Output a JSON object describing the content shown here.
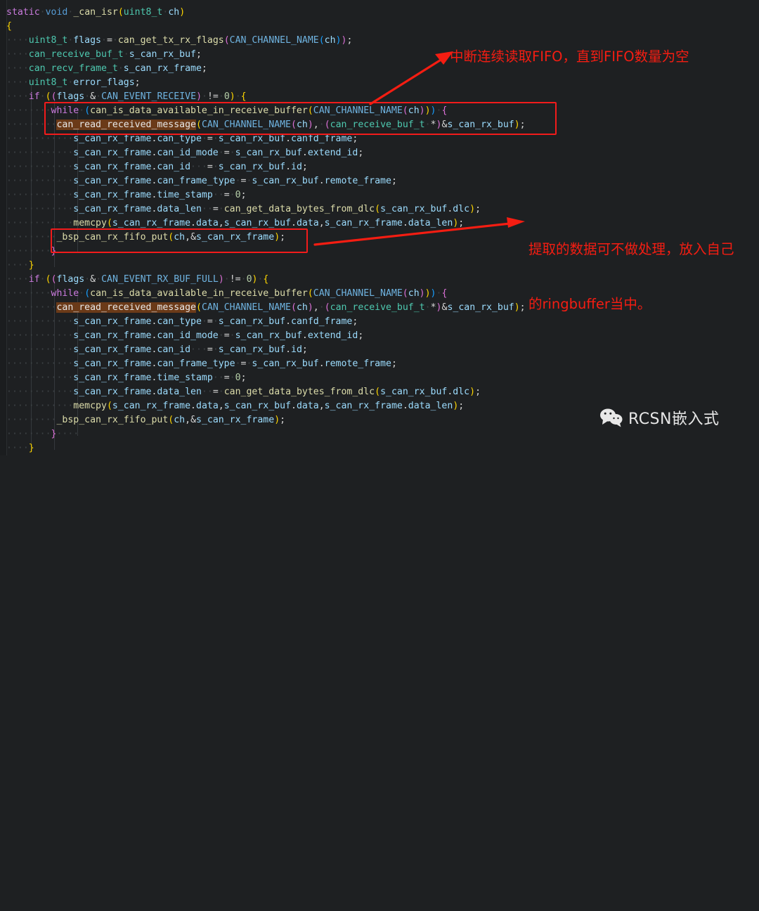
{
  "editor": {
    "background": "#1e2022",
    "gutter_background": "#1b1d1f",
    "highlight_background": "#6b3a18",
    "annotation_color": "#f51d12",
    "font_size_px": 13,
    "line_height_px": 20,
    "line_count": 31,
    "language": "c",
    "whitespace_marker": "·"
  },
  "code": {
    "lines": [
      "static void _can_isr(uint8_t ch)",
      "{",
      "    uint8_t flags = can_get_tx_rx_flags(CAN_CHANNEL_NAME(ch));",
      "    can_receive_buf_t s_can_rx_buf;",
      "    can_recv_frame_t s_can_rx_frame;",
      "    uint8_t error_flags;",
      "    if ((flags & CAN_EVENT_RECEIVE) != 0) {",
      "        while (can_is_data_available_in_receive_buffer(CAN_CHANNEL_NAME(ch))) {",
      "            can_read_received_message(CAN_CHANNEL_NAME(ch), (can_receive_buf_t *)&s_can_rx_buf);",
      "            s_can_rx_frame.can_type = s_can_rx_buf.canfd_frame;",
      "            s_can_rx_frame.can_id_mode = s_can_rx_buf.extend_id;",
      "            s_can_rx_frame.can_id   = s_can_rx_buf.id;",
      "            s_can_rx_frame.can_frame_type = s_can_rx_buf.remote_frame;",
      "            s_can_rx_frame.time_stamp  = 0;",
      "            s_can_rx_frame.data_len  = can_get_data_bytes_from_dlc(s_can_rx_buf.dlc);",
      "            memcpy(s_can_rx_frame.data,s_can_rx_buf.data,s_can_rx_frame.data_len);",
      "            _bsp_can_rx_fifo_put(ch,&s_can_rx_frame);",
      "        }",
      "    }",
      "",
      "    if ((flags & CAN_EVENT_RX_BUF_FULL) != 0) {",
      "        while (can_is_data_available_in_receive_buffer(CAN_CHANNEL_NAME(ch))) {",
      "            can_read_received_message(CAN_CHANNEL_NAME(ch), (can_receive_buf_t *)&s_can_rx_buf);",
      "            s_can_rx_frame.can_type = s_can_rx_buf.canfd_frame;",
      "            s_can_rx_frame.can_id_mode = s_can_rx_buf.extend_id;",
      "            s_can_rx_frame.can_id   = s_can_rx_buf.id;",
      "            s_can_rx_frame.can_frame_type = s_can_rx_buf.remote_frame;",
      "            s_can_rx_frame.time_stamp  = 0;",
      "            s_can_rx_frame.data_len  = can_get_data_bytes_from_dlc(s_can_rx_buf.dlc);",
      "            memcpy(s_can_rx_frame.data,s_can_rx_buf.data,s_can_rx_frame.data_len);",
      "            _bsp_can_rx_fifo_put(ch,&s_can_rx_frame);",
      "        }",
      "    }"
    ],
    "highlighted_token": "can_read_received_message",
    "function_name": "_can_isr"
  },
  "annotations": {
    "note1": "中断连续读取FIFO，直到FIFO数量为空",
    "note2_line1": "提取的数据可不做处理，放入自己",
    "note2_line2": "的ringbuffer当中。",
    "box1_label": "while-loop-read-message-box",
    "box2_label": "fifo-put-box",
    "arrow1_label": "arrow-to-note1",
    "arrow2_label": "arrow-to-note2"
  },
  "watermark": {
    "text": "RCSN嵌入式",
    "icon": "wechat-icon"
  }
}
